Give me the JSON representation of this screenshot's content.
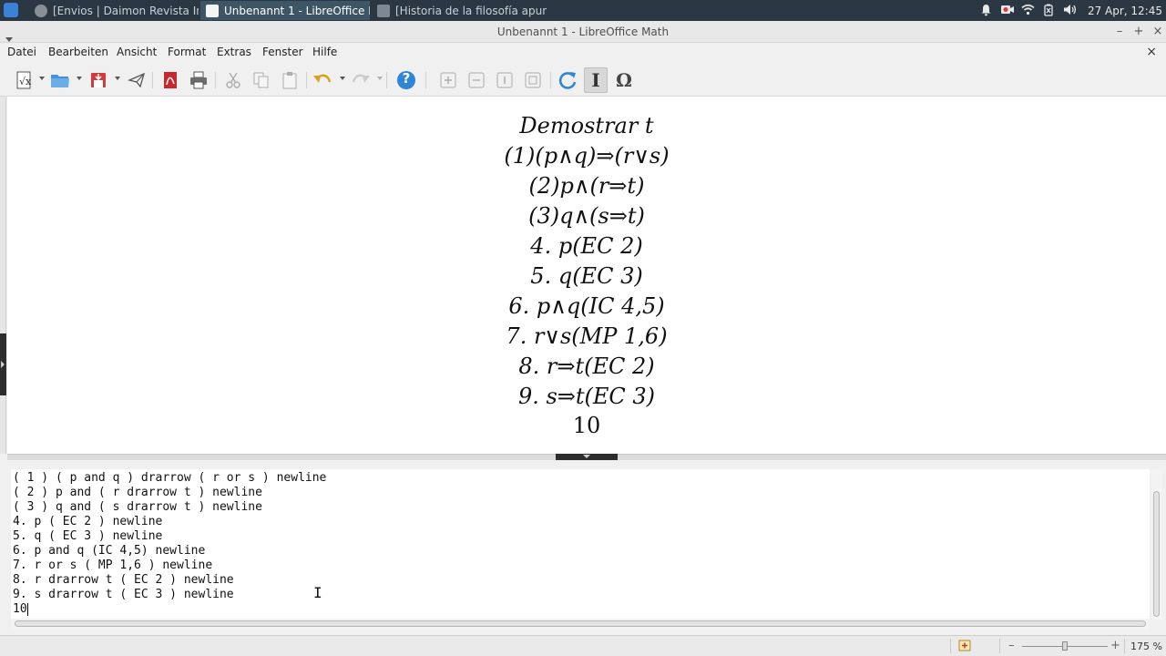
{
  "taskbar": {
    "tasks": [
      {
        "label": "[Envios | Daimon Revista Int...",
        "active": false
      },
      {
        "label": "Unbenannt 1 - LibreOffice M...",
        "active": true
      },
      {
        "label": "[Historia de la filosofía apunt...",
        "active": false
      }
    ],
    "clock": "27 Apr, 12:45"
  },
  "window": {
    "title": "Unbenannt 1 - LibreOffice Math",
    "minimize": "–",
    "maximize": "+",
    "close": "×",
    "doc_close": "×"
  },
  "menubar": {
    "items": [
      "Datei",
      "Bearbeiten",
      "Ansicht",
      "Format",
      "Extras",
      "Fenster",
      "Hilfe"
    ]
  },
  "toolbar": {
    "tools": [
      "formula-new",
      "open",
      "save",
      "send",
      "export-pdf",
      "print",
      "cut",
      "copy",
      "paste",
      "undo",
      "redo",
      "help",
      "zoom-in",
      "zoom-out",
      "zoom-100",
      "show-all",
      "update",
      "formula-cursor",
      "symbols"
    ],
    "formula_cursor_glyph": "I",
    "symbols_glyph": "Ω",
    "help_glyph": "?"
  },
  "formula_view": {
    "lines": [
      "Demostrar t",
      "(1)(p∧q)⇒(r∨s)",
      "(2)p∧(r⇒t)",
      "(3)q∧(s⇒t)",
      "4. p(EC 2)",
      "5. q(EC 3)",
      "6. p∧q(IC 4,5)",
      "7. r∨s(MP 1,6)",
      "8. r⇒t(EC 2)",
      "9. s⇒t(EC 3)",
      "10"
    ]
  },
  "command_editor": {
    "lines": [
      "( 1 ) ( p and q ) drarrow ( r or s ) newline",
      "( 2 ) p and ( r drarrow t ) newline",
      "( 3 ) q and ( s drarrow t ) newline",
      "4. p ( EC 2 ) newline",
      "5. q ( EC 3 ) newline",
      "6. p and q (IC 4,5) newline",
      "7. r or s ( MP 1,6 ) newline",
      "8. r drarrow t ( EC 2 ) newline",
      "9. s drarrow t ( EC 3 ) newline",
      "10"
    ]
  },
  "statusbar": {
    "zoom_percent": "175 %",
    "zoom_minus": "–",
    "zoom_plus": "+",
    "zoom_level": 0.5
  }
}
